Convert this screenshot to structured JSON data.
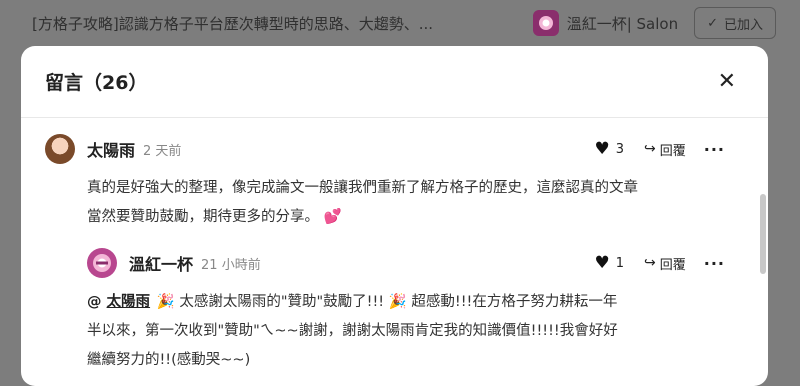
{
  "header": {
    "article_title": "[方格子攻略]認識方格子平台歷次轉型時的思路、大趨勢、...",
    "brand_name": "溫紅一杯| Salon",
    "joined_label": "已加入"
  },
  "modal": {
    "title": "留言（26）"
  },
  "comments": [
    {
      "author": "太陽雨",
      "time": "2 天前",
      "likes": "3",
      "reply_label": "回覆",
      "more_label": "···",
      "body_line1": "真的是好強大的整理，像完成論文一般讓我們重新了解方格子的歷史，這麼認真的文章",
      "body_line2": "當然要贊助鼓勵，期待更多的分享。",
      "emoji": "💕"
    },
    {
      "author": "溫紅一杯",
      "time": "21 小時前",
      "likes": "1",
      "reply_label": "回覆",
      "more_label": "···",
      "mention_at": "@",
      "mention_name": "太陽雨",
      "body_line1": "🎉 太感謝太陽雨的\"贊助\"鼓勵了!!! 🎉 超感動!!!在方格子努力耕耘一年",
      "body_line2": "半以來，第一次收到\"贊助\"ㄟ~~謝謝，謝謝太陽雨肯定我的知識價值!!!!!我會好好",
      "body_line3": "繼續努力的!!(感動哭~~)"
    }
  ],
  "colors": {
    "overlay": "#7d7d7d",
    "modal_bg": "#ffffff",
    "accent_pink": "#e0389d",
    "brand": "#8a2e6c"
  }
}
